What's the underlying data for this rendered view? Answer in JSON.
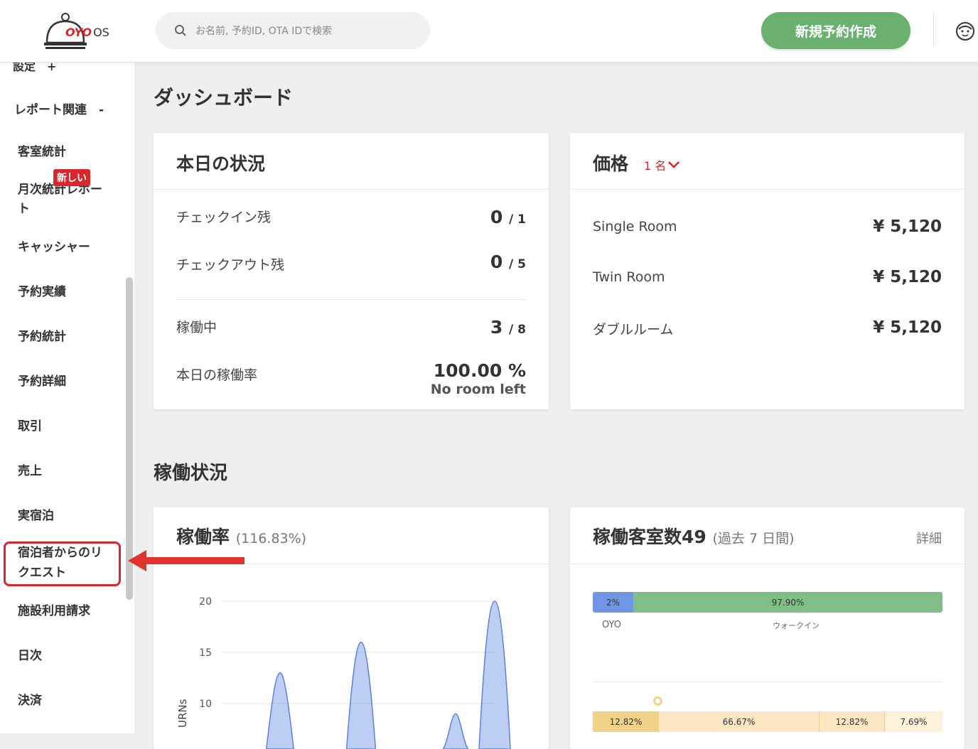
{
  "header": {
    "logo": {
      "brand": "OYO",
      "suffix": "OS"
    },
    "search_placeholder": "お名前, 予約ID, OTA IDで検索",
    "new_booking_label": "新規予約作成"
  },
  "sidebar": {
    "top_item": "設定　+",
    "section_label": "レポート関連　-",
    "new_badge": "新しい",
    "items": [
      {
        "label": "客室統計"
      },
      {
        "label": "月次統計レポー"
      },
      {
        "label": "ト"
      },
      {
        "label": "キャッシャー"
      },
      {
        "label": "予約実績"
      },
      {
        "label": "予約統計"
      },
      {
        "label": "予約詳細"
      },
      {
        "label": "取引"
      },
      {
        "label": "売上"
      },
      {
        "label": "実宿泊"
      },
      {
        "label": "宿泊者からのリ"
      },
      {
        "label": "クエスト"
      },
      {
        "label": "施設利用請求"
      },
      {
        "label": "日次"
      },
      {
        "label": "決済"
      }
    ]
  },
  "dashboard": {
    "title": "ダッシュボード",
    "today": {
      "title": "本日の状況",
      "rows": [
        {
          "label": "チェックイン残",
          "value": "0",
          "total": "/ 1"
        },
        {
          "label": "チェックアウト残",
          "value": "0",
          "total": "/ 5"
        },
        {
          "label": "稼働中",
          "value": "3",
          "total": "/ 8"
        }
      ],
      "occupancy_label": "本日の稼働率",
      "occupancy_value": "100.00 %",
      "occupancy_note": "No room left"
    },
    "price": {
      "title": "価格",
      "guest_selector": "1 名",
      "rows": [
        {
          "label": "Single Room",
          "value": "¥ 5,120"
        },
        {
          "label": "Twin Room",
          "value": "¥ 5,120"
        },
        {
          "label": "ダブルルーム",
          "value": "¥ 5,120"
        }
      ]
    }
  },
  "occupancy_section": {
    "title": "稼働状況",
    "rate_card": {
      "title": "稼働率",
      "subtitle": "(116.83%)",
      "ylabel": "URNs",
      "yticks": [
        "20",
        "15",
        "10"
      ]
    },
    "rooms_card": {
      "title": "稼働客室数49",
      "subtitle": "(過去 7 日間)",
      "detail_link": "詳細",
      "bar1": [
        {
          "label": "2%",
          "sub": "OYO",
          "color": "#6f95e3"
        },
        {
          "label": "97.90%",
          "sub": "ウォークイン",
          "color": "#7fbf86"
        }
      ],
      "bar2": [
        {
          "label": "12.82%",
          "color": "#f2d289"
        },
        {
          "label": "66.67%",
          "color": "#fbe7c2"
        },
        {
          "label": "12.82%",
          "color": "#fbe7c2"
        },
        {
          "label": "7.69%",
          "color": "#fdf1dc"
        }
      ]
    }
  },
  "chart_data": {
    "type": "area",
    "title": "稼働率",
    "ylabel": "URNs",
    "ylim": [
      5,
      20
    ],
    "yticks": [
      20,
      15,
      10
    ],
    "series": [
      {
        "values": [
          0,
          13,
          0,
          16,
          0,
          9,
          0,
          20
        ]
      }
    ]
  }
}
